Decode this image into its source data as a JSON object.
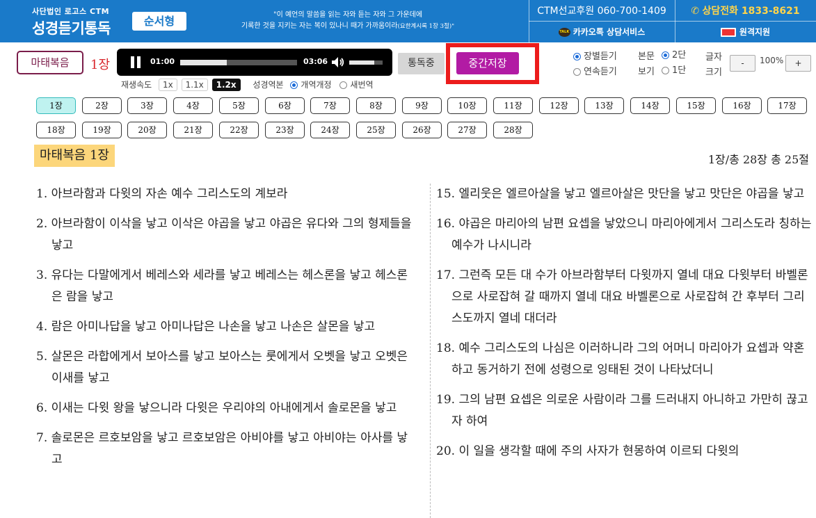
{
  "header": {
    "org_sub": "사단법인 로고스 CTM",
    "logo_title": "성경듣기통독",
    "badge": "순서형",
    "verse_line1": "\"이 예언의 말씀을 읽는 자와 듣는 자와 그 가운데에",
    "verse_line2": "기록한 것을 지키는 자는 복이 있나니 때가 가까움이라",
    "verse_ref": "(요한계시록 1장 3절)\"",
    "sponsor": "CTM선교후원 060-700-1409",
    "consult_phone": "상담전화 1833-8621",
    "kakao": "카카오톡 상담서비스",
    "kakao_icon_text": "TALK",
    "remote": "원격지원"
  },
  "player": {
    "book": "마태복음",
    "chapter": "1장",
    "current_time": "01:00",
    "total_time": "03:06",
    "progress_pct": 40,
    "volume_pct": 75,
    "read_btn": "통독중",
    "save_btn": "중간저장"
  },
  "speed": {
    "label": "재생속도",
    "options": [
      "1x",
      "1.1x",
      "1.2x"
    ],
    "selected": "1.2x"
  },
  "version": {
    "label": "성경역본",
    "options": [
      "개역개정",
      "새번역"
    ],
    "selected": "개역개정"
  },
  "listen_mode": {
    "options": [
      "장별듣기",
      "연속듣기"
    ],
    "selected": "장별듣기"
  },
  "text_view": {
    "label1": "본문",
    "label2": "보기",
    "options": [
      "2단",
      "1단"
    ],
    "selected": "2단"
  },
  "font_size": {
    "label1": "글자",
    "label2": "크기",
    "minus": "-",
    "plus": "+",
    "value": "100%"
  },
  "chapters": {
    "row1": [
      "1장",
      "2장",
      "3장",
      "4장",
      "5장",
      "6장",
      "7장",
      "8장",
      "9장",
      "10장",
      "11장",
      "12장",
      "13장",
      "14장",
      "15장",
      "16장",
      "17장"
    ],
    "row2": [
      "18장",
      "19장",
      "20장",
      "21장",
      "22장",
      "23장",
      "24장",
      "25장",
      "26장",
      "27장",
      "28장"
    ],
    "active": "1장"
  },
  "content": {
    "title": "마태복음  1장",
    "meta": "1장/총 28장   총 25절",
    "left": [
      "1. 아브라함과 다윗의 자손 예수 그리스도의 계보라",
      "2. 아브라함이 이삭을 낳고 이삭은 야곱을 낳고 야곱은 유다와 그의 형제들을 낳고",
      "3. 유다는 다말에게서 베레스와 세라를 낳고 베레스는 헤스론을 낳고 헤스론은 람을 낳고",
      "4. 람은 아미나답을 낳고 아미나답은 나손을 낳고 나손은 살몬을 낳고",
      "5. 살몬은 라합에게서 보아스를 낳고 보아스는 룻에게서 오벳을 낳고 오벳은 이새를 낳고",
      "6. 이새는 다윗 왕을 낳으니라 다윗은 우리야의 아내에게서 솔로몬을 낳고",
      "7. 솔로몬은 르호보암을 낳고 르호보암은 아비야를 낳고 아비야는 아사를 낳고"
    ],
    "right": [
      "15. 엘리웃은 엘르아살을 낳고 엘르아살은 맛단을 낳고 맛단은 야곱을 낳고",
      "16. 야곱은 마리아의 남편 요셉을 낳았으니 마리아에게서 그리스도라 칭하는 예수가 나시니라",
      "17. 그런즉 모든 대 수가 아브라함부터 다윗까지 열네 대요 다윗부터 바벨론으로 사로잡혀 갈 때까지 열네 대요 바벨론으로 사로잡혀 간 후부터 그리스도까지 열네 대더라",
      "18. 예수 그리스도의 나심은 이러하니라 그의 어머니 마리아가 요셉과 약혼하고 동거하기 전에 성령으로 잉태된 것이 나타났더니",
      "19. 그의 남편 요셉은 의로운 사람이라 그를 드러내지 아니하고 가만히 끊고자 하여",
      "20. 이 일을 생각할 때에 주의 사자가 현몽하여 이르되 다윗의"
    ]
  },
  "colors": {
    "header_bg": "#1a7ac9",
    "save_btn": "#b21ba4",
    "highlight_box": "#ec1c1c",
    "title_bg": "#fcd67b",
    "active_chapter": "#bff2f0",
    "chapter_red": "#d9262c"
  }
}
